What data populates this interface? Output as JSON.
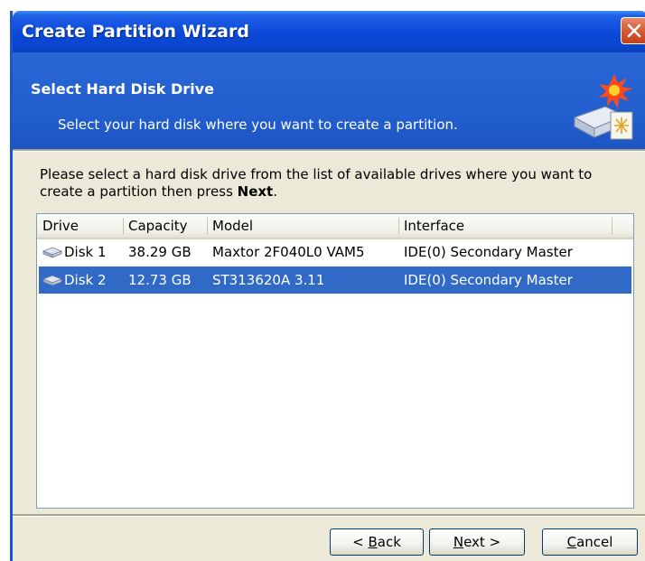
{
  "window": {
    "title": "Create Partition Wizard"
  },
  "header": {
    "title": "Select Hard Disk Drive",
    "subtitle": "Select your hard disk where you want to create a partition."
  },
  "instruction": {
    "text_before": "Please select a hard disk drive from the list of available drives where you want to create a partition then press ",
    "bold": "Next",
    "text_after": "."
  },
  "table": {
    "columns": [
      "Drive",
      "Capacity",
      "Model",
      "Interface"
    ],
    "rows": [
      {
        "drive": "Disk 1",
        "capacity": "38.29 GB",
        "model": "Maxtor 2F040L0 VAM5",
        "interface": "IDE(0) Secondary Master",
        "selected": false
      },
      {
        "drive": "Disk 2",
        "capacity": "12.73 GB",
        "model": "ST313620A 3.11",
        "interface": "IDE(0) Secondary Master",
        "selected": true
      }
    ]
  },
  "buttons": {
    "back": {
      "prefix": "< ",
      "accel": "B",
      "rest": "ack"
    },
    "next": {
      "accel": "N",
      "rest": "ext >"
    },
    "cancel": {
      "accel": "C",
      "rest": "ancel"
    }
  },
  "icons": {
    "close": "close-icon",
    "wizard": "hard-disk-wizard-icon",
    "disk": "hard-disk-icon"
  },
  "colors": {
    "title_bar": "#0a49d8",
    "header_band": "#235fcf",
    "selection": "#3169c6",
    "dialog_face": "#ece9d8",
    "close_button": "#d75a33"
  }
}
